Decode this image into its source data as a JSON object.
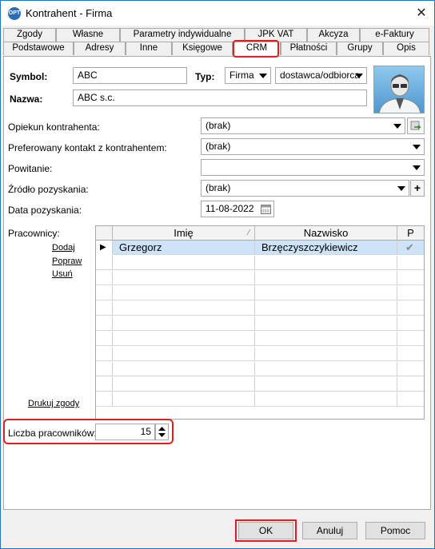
{
  "window": {
    "title": "Kontrahent - Firma",
    "close_glyph": "✕",
    "app_icon_text": "OPT"
  },
  "tabs_row1": [
    "Zgody",
    "Własne",
    "Parametry indywidualne",
    "JPK VAT",
    "Akcyza",
    "e-Faktury"
  ],
  "tabs_row2": [
    "Podstawowe",
    "Adresy",
    "Inne",
    "Księgowe",
    "CRM",
    "Płatności",
    "Grupy",
    "Opis"
  ],
  "active_tab": "CRM",
  "form": {
    "symbol_label": "Symbol:",
    "symbol_value": "ABC",
    "typ_label": "Typ:",
    "typ_value": "Firma",
    "typ2_value": "dostawca/odbiorca",
    "nazwa_label": "Nazwa:",
    "nazwa_value": "ABC s.c.",
    "opiekun_label": "Opiekun kontrahenta:",
    "opiekun_value": "(brak)",
    "kontakt_label": "Preferowany kontakt z kontrahentem:",
    "kontakt_value": "(brak)",
    "powitanie_label": "Powitanie:",
    "powitanie_value": "",
    "zrodlo_label": "Źródło pozyskania:",
    "zrodlo_value": "(brak)",
    "data_label": "Data pozyskania:",
    "data_value": "11-08-2022",
    "pracownicy_label": "Pracownicy:",
    "liczba_label": "Liczba pracowników:",
    "liczba_value": "15"
  },
  "grid": {
    "headers": [
      "Imię",
      "Nazwisko",
      "P"
    ],
    "rows": [
      {
        "imie": "Grzegorz",
        "nazwisko": "Brzęczyszczykiewicz",
        "p": "✔"
      }
    ],
    "selected_marker": "▶",
    "sort_glyph": "⁄"
  },
  "links": {
    "dodaj": "Dodaj",
    "popraw": "Popraw",
    "usun": "Usuń",
    "drukuj": "Drukuj zgody"
  },
  "side_buttons": {
    "add_glyph": "+"
  },
  "buttons": {
    "ok": "OK",
    "cancel": "Anuluj",
    "help": "Pomoc"
  },
  "colors": {
    "highlight": "#e01e1e",
    "selected_row": "#cde3f7",
    "window_border": "#1e74c8"
  }
}
